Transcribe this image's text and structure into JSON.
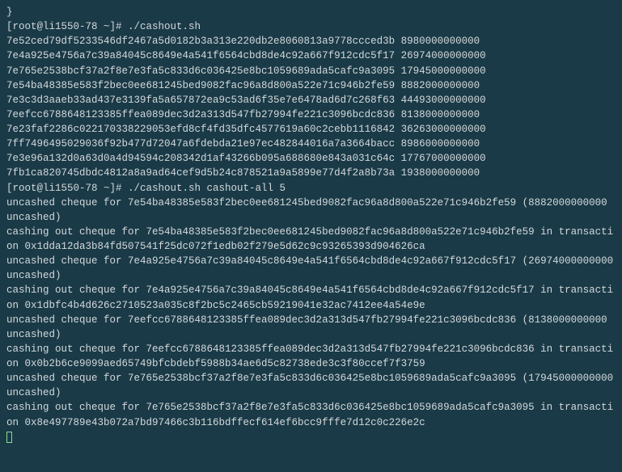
{
  "lines": {
    "brace": "}",
    "prompt1": "[root@li1550-78 ~]# ./cashout.sh",
    "b1": "7e52ced79df5233546df2467a5d0182b3a313e220db2e8060813a9778ccced3b 8980000000000",
    "b2": "7e4a925e4756a7c39a84045c8649e4a541f6564cbd8de4c92a667f912cdc5f17 26974000000000",
    "b3": "7e765e2538bcf37a2f8e7e3fa5c833d6c036425e8bc1059689ada5cafc9a3095 17945000000000",
    "b4": "7e54ba48385e583f2bec0ee681245bed9082fac96a8d800a522e71c946b2fe59 8882000000000",
    "b5": "7e3c3d3aaeb33ad437e3139fa5a657872ea9c53ad6f35e7e6478ad6d7c268f63 44493000000000",
    "b6": "7eefcc6788648123385ffea089dec3d2a313d547fb27994fe221c3096bcdc836 8138000000000",
    "b7": "7e23faf2286c022170338229053efd8cf4fd35dfc4577619a60c2cebb1116842 36263000000000",
    "b8": "7ff7496495029036f92b477d72047a6fdebda21e97ec482844016a7a3664bacc 8986000000000",
    "b9": "7e3e96a132d0a63d0a4d94594c208342d1af43266b095a688680e843a031c64c 17767000000000",
    "b10": "7fb1ca820745dbdc4812a8a9ad64cef9d5b24c878521a9a5899e77d4f2a8b73a 1938000000000",
    "prompt2": "[root@li1550-78 ~]# ./cashout.sh cashout-all 5",
    "u1": "uncashed cheque for 7e54ba48385e583f2bec0ee681245bed9082fac96a8d800a522e71c946b2fe59 (8882000000000 uncashed)",
    "c1": "cashing out cheque for 7e54ba48385e583f2bec0ee681245bed9082fac96a8d800a522e71c946b2fe59 in transaction 0x1dda12da3b84fd507541f25dc072f1edb02f279e5d62c9c93265393d904626ca",
    "u2": "uncashed cheque for 7e4a925e4756a7c39a84045c8649e4a541f6564cbd8de4c92a667f912cdc5f17 (26974000000000 uncashed)",
    "c2": "cashing out cheque for 7e4a925e4756a7c39a84045c8649e4a541f6564cbd8de4c92a667f912cdc5f17 in transaction 0x1dbfc4b4d626c2710523a035c8f2bc5c2465cb59219041e32ac7412ee4a54e9e",
    "u3": "uncashed cheque for 7eefcc6788648123385ffea089dec3d2a313d547fb27994fe221c3096bcdc836 (8138000000000 uncashed)",
    "c3": "cashing out cheque for 7eefcc6788648123385ffea089dec3d2a313d547fb27994fe221c3096bcdc836 in transaction 0x0b2b6ce9099aed65749bfcbdebf5988b34ae6d5c82738ede3c3f80ccef7f3759",
    "u4": "uncashed cheque for 7e765e2538bcf37a2f8e7e3fa5c833d6c036425e8bc1059689ada5cafc9a3095 (17945000000000 uncashed)",
    "c4": "cashing out cheque for 7e765e2538bcf37a2f8e7e3fa5c833d6c036425e8bc1059689ada5cafc9a3095 in transaction 0x8e497789e43b072a7bd97466c3b116bdffecf614ef6bcc9fffe7d12c0c226e2c"
  }
}
